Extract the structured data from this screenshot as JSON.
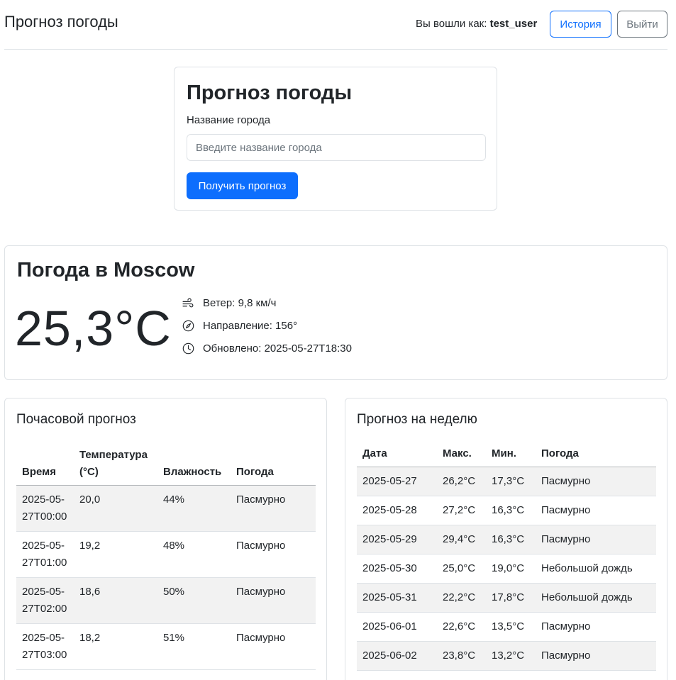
{
  "header": {
    "brand": "Прогноз погоды",
    "user_prefix": "Вы вошли как:",
    "username": "test_user",
    "history_label": "История",
    "logout_label": "Выйти"
  },
  "search": {
    "title": "Прогноз погоды",
    "city_label": "Название города",
    "placeholder": "Введите название города",
    "value": "",
    "submit_label": "Получить прогноз"
  },
  "current": {
    "title": "Погода в Moscow",
    "temperature": "25,3°C",
    "wind": "Ветер: 9,8 км/ч",
    "direction": "Направление: 156°",
    "updated": "Обновлено: 2025-05-27T18:30",
    "icons": [
      "wind-icon",
      "compass-icon",
      "clock-icon"
    ]
  },
  "hourly": {
    "title": "Почасовой прогноз",
    "columns": [
      "Время",
      "Температура (°C)",
      "Влажность",
      "Погода"
    ],
    "rows": [
      {
        "time": "2025-05-27T00:00",
        "temp": "20,0",
        "humidity": "44%",
        "weather": "Пасмурно"
      },
      {
        "time": "2025-05-27T01:00",
        "temp": "19,2",
        "humidity": "48%",
        "weather": "Пасмурно"
      },
      {
        "time": "2025-05-27T02:00",
        "temp": "18,6",
        "humidity": "50%",
        "weather": "Пасмурно"
      },
      {
        "time": "2025-05-27T03:00",
        "temp": "18,2",
        "humidity": "51%",
        "weather": "Пасмурно"
      }
    ]
  },
  "weekly": {
    "title": "Прогноз на неделю",
    "columns": [
      "Дата",
      "Макс.",
      "Мин.",
      "Погода"
    ],
    "rows": [
      {
        "date": "2025-05-27",
        "max": "26,2°C",
        "min": "17,3°C",
        "weather": "Пасмурно"
      },
      {
        "date": "2025-05-28",
        "max": "27,2°C",
        "min": "16,3°C",
        "weather": "Пасмурно"
      },
      {
        "date": "2025-05-29",
        "max": "29,4°C",
        "min": "16,3°C",
        "weather": "Пасмурно"
      },
      {
        "date": "2025-05-30",
        "max": "25,0°C",
        "min": "19,0°C",
        "weather": "Небольшой дождь"
      },
      {
        "date": "2025-05-31",
        "max": "22,2°C",
        "min": "17,8°C",
        "weather": "Небольшой дождь"
      },
      {
        "date": "2025-06-01",
        "max": "22,6°C",
        "min": "13,5°C",
        "weather": "Пасмурно"
      },
      {
        "date": "2025-06-02",
        "max": "23,8°C",
        "min": "13,2°C",
        "weather": "Пасмурно"
      }
    ]
  },
  "colors": {
    "primary": "#0d6efd",
    "secondary": "#6c757d",
    "border": "#dee2e6",
    "stripe": "#f2f2f2",
    "text": "#212529"
  }
}
